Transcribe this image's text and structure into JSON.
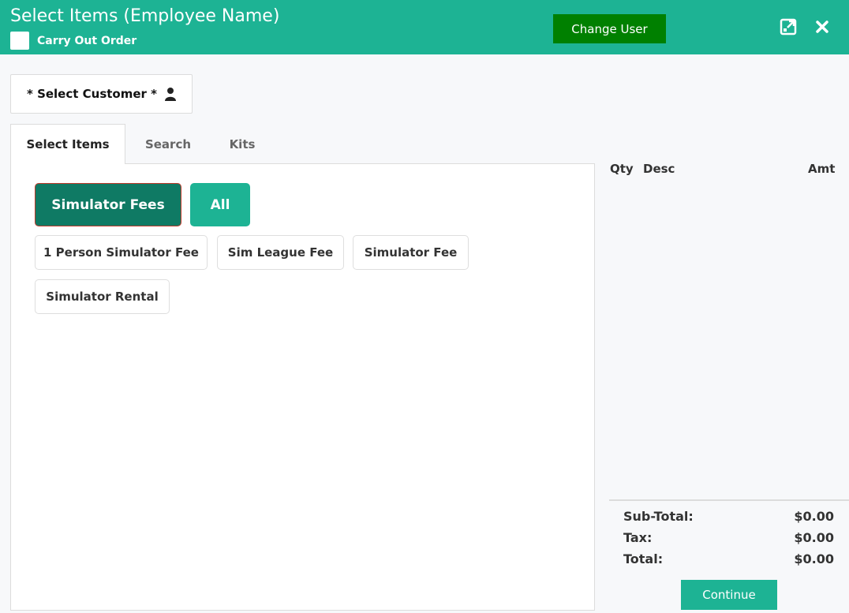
{
  "header": {
    "title": "Select Items (Employee Name)",
    "carry_out_label": "Carry Out Order",
    "change_user_label": "Change User"
  },
  "customer": {
    "select_label": "* Select Customer *"
  },
  "tabs": [
    {
      "label": "Select Items",
      "active": true
    },
    {
      "label": "Search",
      "active": false
    },
    {
      "label": "Kits",
      "active": false
    }
  ],
  "categories": [
    {
      "label": "Simulator Fees",
      "selected": true
    },
    {
      "label": "All",
      "selected": false
    }
  ],
  "items": [
    {
      "label": "1 Person Simulator Fee"
    },
    {
      "label": "Sim League Fee"
    },
    {
      "label": "Simulator Fee"
    },
    {
      "label": "Simulator Rental"
    }
  ],
  "order": {
    "columns": {
      "qty": "Qty",
      "desc": "Desc",
      "amt": "Amt"
    },
    "subtotal_label": "Sub-Total:",
    "subtotal_value": "$0.00",
    "tax_label": "Tax:",
    "tax_value": "$0.00",
    "total_label": "Total:",
    "total_value": "$0.00",
    "continue_label": "Continue"
  },
  "colors": {
    "header_bg": "#1db394",
    "change_user_bg": "#008000",
    "category_selected_bg": "#0f7a64"
  }
}
